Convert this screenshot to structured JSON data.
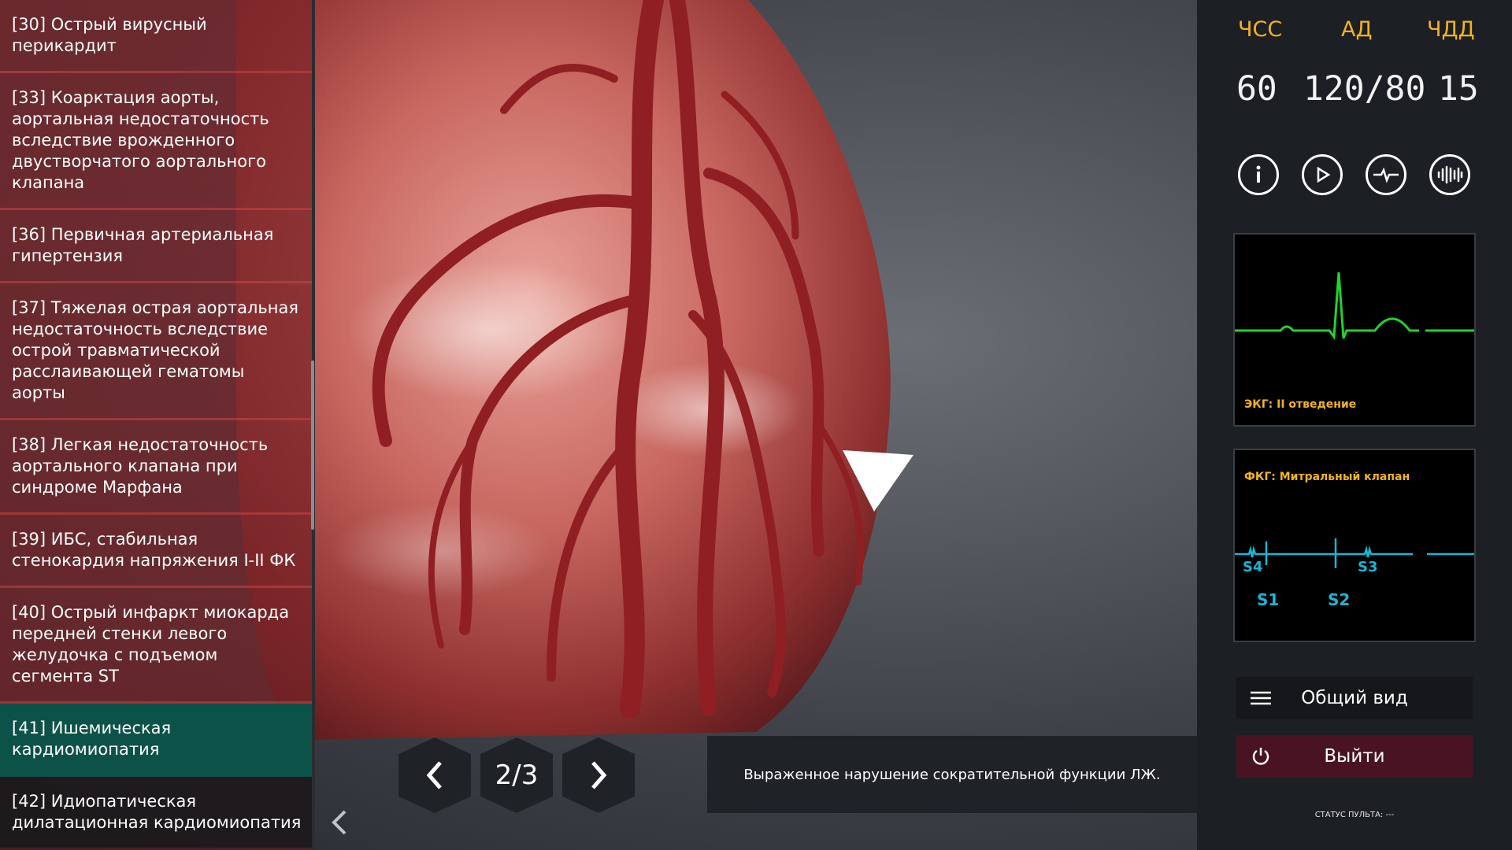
{
  "case_list": {
    "items": [
      {
        "label": "[30] Острый вирусный перикардит"
      },
      {
        "label": "[33] Коарктация аорты, аортальная недостаточность вследствие врожденного двустворчатого аортального клапана"
      },
      {
        "label": "[36] Первичная артериальная гипертензия"
      },
      {
        "label": "[37] Тяжелая острая аортальная недостаточность вследствие острой травматической расслаивающей гематомы аорты"
      },
      {
        "label": "[38] Легкая недостаточность аортального клапана при синдроме Марфана"
      },
      {
        "label": "[39] ИБС, стабильная стенокардия напряжения I-II ФК"
      },
      {
        "label": "[40] Острый инфаркт миокарда передней стенки левого желудочка с подъемом сегмента ST"
      },
      {
        "label": "[41] Ишемическая кардиомиопатия",
        "active": true
      },
      {
        "label": "[42] Идиопатическая дилатационная кардиомиопатия"
      }
    ]
  },
  "vitals": {
    "hr_label": "ЧСС",
    "hr_value": "60",
    "bp_label": "АД",
    "bp_value": "120/80",
    "rr_label": "ЧДД",
    "rr_value": "15"
  },
  "toolbar": {
    "icons": [
      "info-icon",
      "play-icon",
      "ecg-icon",
      "sound-wave-icon"
    ]
  },
  "ecg": {
    "label": "ЭКГ: II отведение",
    "color": "#21d42b"
  },
  "pcg": {
    "label": "ФКГ: Митральный клапан",
    "color": "#19b6d6",
    "marks": {
      "s4": "S4",
      "s3": "S3",
      "s1": "S1",
      "s2": "S2"
    }
  },
  "menu": {
    "overview_label": "Общий вид",
    "exit_label": "Выйти",
    "exit_color": "#4a1324"
  },
  "nav": {
    "page": "2/3"
  },
  "description": "Выраженное нарушение сократительной функции ЛЖ.",
  "status": "СТАТУС ПУЛЬТА: ---",
  "colors": {
    "accent": "#f2b31d",
    "active_case": "#0d5248"
  }
}
